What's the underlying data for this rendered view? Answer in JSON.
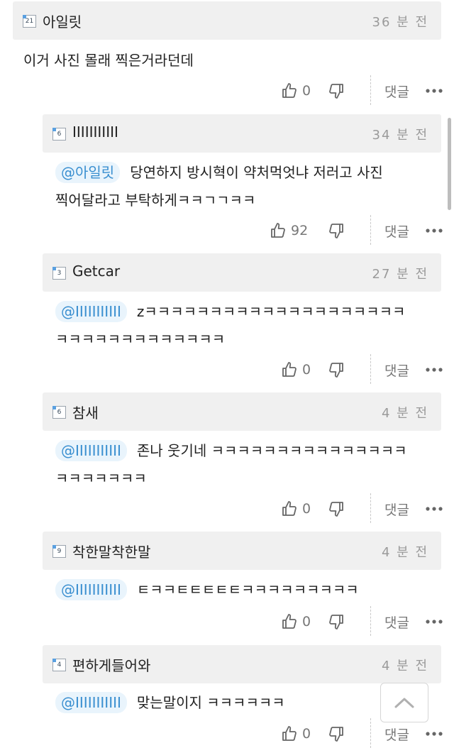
{
  "comments": [
    {
      "level": "21",
      "nick": "아일릿",
      "time": "36 분 전",
      "mention": "",
      "text": "이거 사진 몰래 찍은거라던데",
      "likes": "0",
      "reply_label": "댓글"
    },
    {
      "level": "6",
      "nick": "IIIIIIIIIII",
      "time": "34 분 전",
      "mention": "@아일릿",
      "text1": "당연하지 방시혁이 약처먹엇냐 저러고 사진",
      "text2": "찍어달라고 부탁하게ㅋㅋㄱㄱㅋㅋ",
      "likes": "92",
      "reply_label": "댓글"
    },
    {
      "level": "3",
      "nick": "Getcar",
      "time": "27 분 전",
      "mention": "@IIIIIIIIIII",
      "text1": "zㅋㅋㅋㅋㅋㅋㅋㅋㅋㅋㅋㅋㅋㅋㅋㅋㅋㅋㅋㅋ",
      "text2": "ㅋㅋㅋㅋㅋㅋㅋㅋㅋㅋㅋㅋㅋ",
      "likes": "0",
      "reply_label": "댓글"
    },
    {
      "level": "6",
      "nick": "참새",
      "time": "4 분 전",
      "mention": "@IIIIIIIIIII",
      "text1": "존나 웃기네 ㅋㅋㅋㅋㅋㅋㅋㅋㅋㅋㅋㅋㅋㅋㅋ",
      "text2": "ㅋㅋㅋㅋㅋㅋㅋ",
      "likes": "0",
      "reply_label": "댓글"
    },
    {
      "level": "9",
      "nick": "착한말착한말",
      "time": "4 분 전",
      "mention": "@IIIIIIIIIII",
      "text1": "ㅌㅋㅋㅌㅌㅌㅌㅌㅋㅋㅋㅋㅋㅋㅋㅋㅋ",
      "likes": "0",
      "reply_label": "댓글"
    },
    {
      "level": "4",
      "nick": "편하게들어와",
      "time": "4 분 전",
      "mention": "@IIIIIIIIIII",
      "text1": "맞는말이지 ㅋㅋㅋㅋㅋㅋ",
      "likes": "0",
      "reply_label": "댓글"
    }
  ],
  "icons": {
    "like": "thumbs-up-icon",
    "dislike": "thumbs-down-icon",
    "more": "more-dots-icon",
    "top": "chevron-up-icon"
  }
}
